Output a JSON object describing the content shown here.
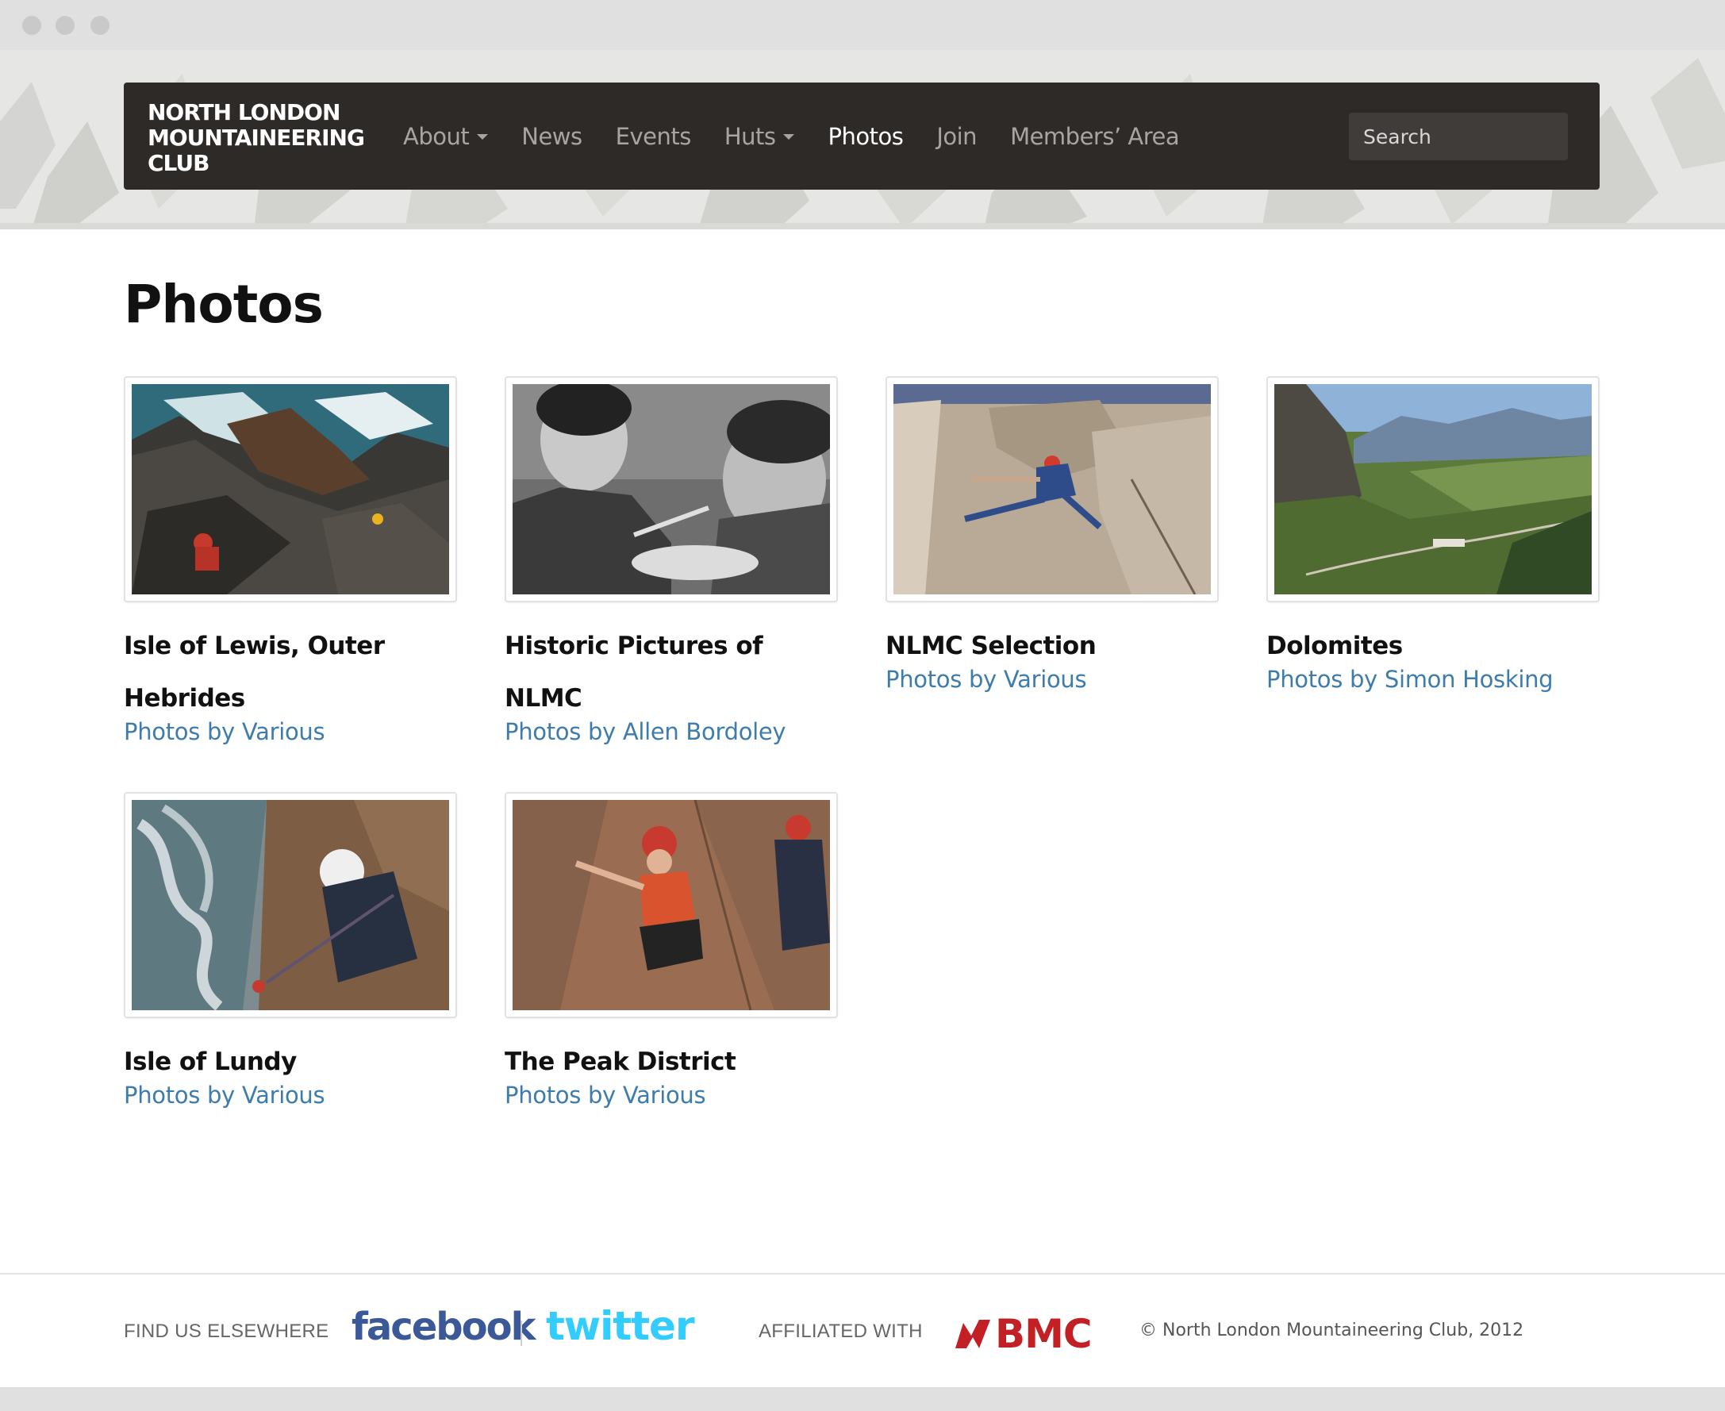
{
  "header": {
    "brand": "NORTH LONDON MOUNTAINEERING CLUB",
    "nav": [
      {
        "label": "About",
        "dropdown": true,
        "active": false
      },
      {
        "label": "News",
        "dropdown": false,
        "active": false
      },
      {
        "label": "Events",
        "dropdown": false,
        "active": false
      },
      {
        "label": "Huts",
        "dropdown": true,
        "active": false
      },
      {
        "label": "Photos",
        "dropdown": false,
        "active": true
      },
      {
        "label": "Join",
        "dropdown": false,
        "active": false
      },
      {
        "label": "Members’ Area",
        "dropdown": false,
        "active": false
      }
    ],
    "search_placeholder": "Search"
  },
  "main": {
    "title": "Photos",
    "albums": [
      {
        "title": "Isle of Lewis, Outer Hebrides",
        "byline": "Photos by Various",
        "photo": "sea-cliff-climber"
      },
      {
        "title": "Historic Pictures of NLMC",
        "byline": "Photos by Allen Bordoley",
        "photo": "black-and-white-portrait"
      },
      {
        "title": "NLMC Selection",
        "byline": "Photos by Various",
        "photo": "rock-face-climber"
      },
      {
        "title": "Dolomites",
        "byline": "Photos by Simon Hosking",
        "photo": "alpine-valley"
      },
      {
        "title": "Isle of Lundy",
        "byline": "Photos by Various",
        "photo": "helmeted-climber-above-sea"
      },
      {
        "title": "The Peak District",
        "byline": "Photos by Various",
        "photo": "two-climbers-red-helmets"
      }
    ]
  },
  "footer": {
    "find_label": "FIND US ELSEWHERE",
    "facebook": "facebook",
    "twitter": "twitter",
    "affiliated_label": "AFFILIATED WITH",
    "bmc": "BMC",
    "copyright": "© North London Mountaineering Club, 2012"
  },
  "colors": {
    "navbar_bg": "#2d2a28",
    "link": "#3d7cab",
    "facebook": "#3b5998",
    "twitter": "#33ccff",
    "bmc": "#c32026"
  }
}
